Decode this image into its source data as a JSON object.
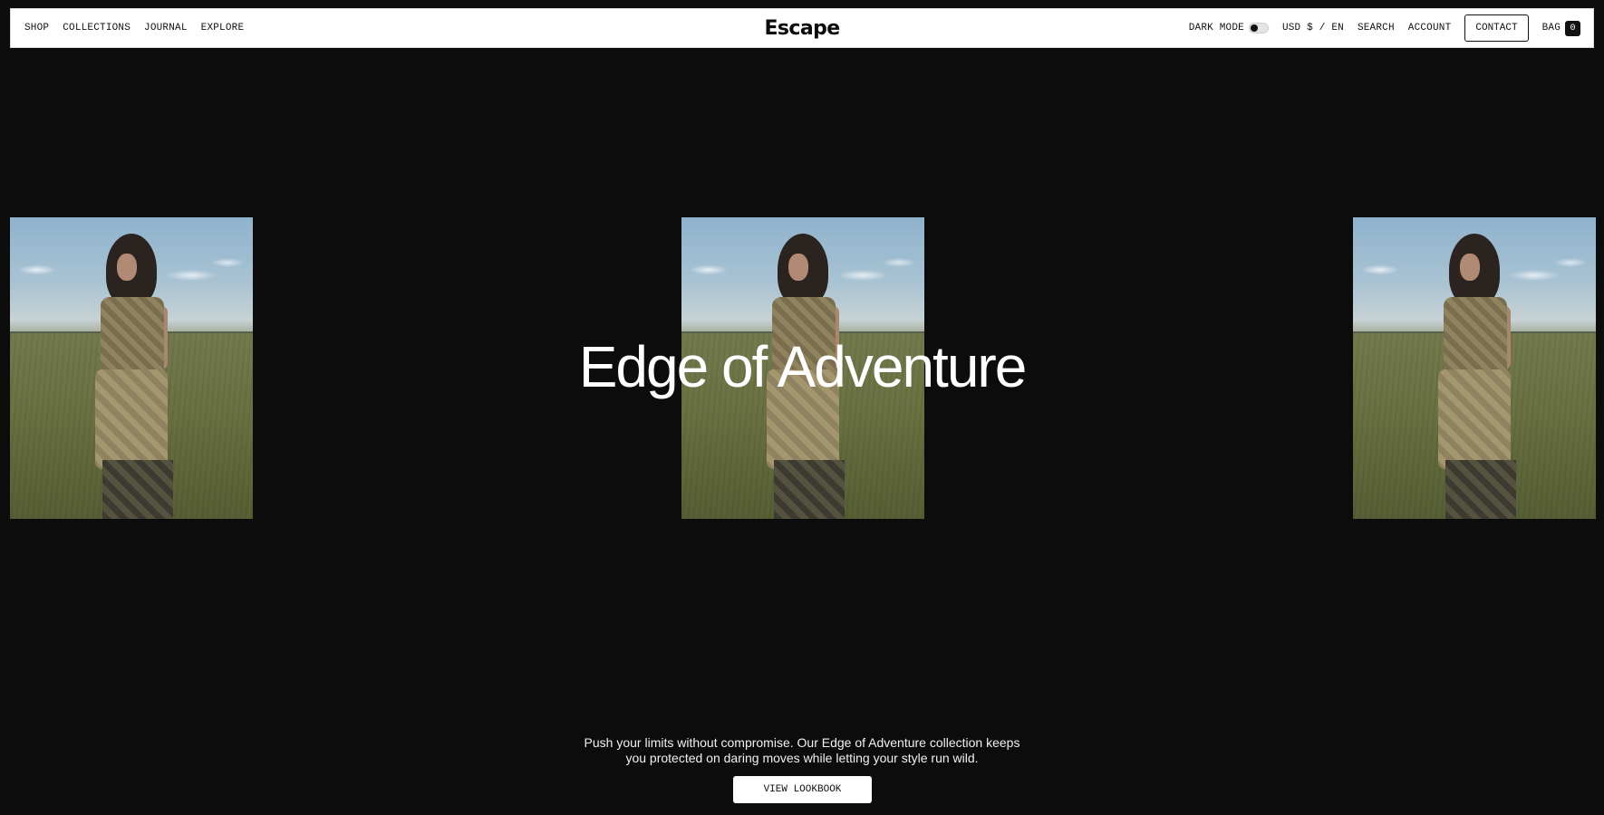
{
  "header": {
    "nav_left": [
      "SHOP",
      "COLLECTIONS",
      "JOURNAL",
      "EXPLORE"
    ],
    "logo": "Escape",
    "dark_mode_label": "DARK MODE",
    "currency_lang": "USD $ / EN",
    "search_label": "SEARCH",
    "account_label": "ACCOUNT",
    "contact_label": "CONTACT",
    "bag_label": "BAG",
    "bag_count": "0"
  },
  "hero": {
    "title": "Edge of Adventure",
    "description": "Push your limits without compromise. Our Edge of Adventure collection keeps you protected on daring moves while letting your style run wild.",
    "cta_label": "VIEW LOOKBOOK"
  },
  "colors": {
    "background": "#0c0c0c",
    "header_bg": "#ffffff",
    "text_dark": "#111111",
    "text_light": "#ffffff"
  }
}
